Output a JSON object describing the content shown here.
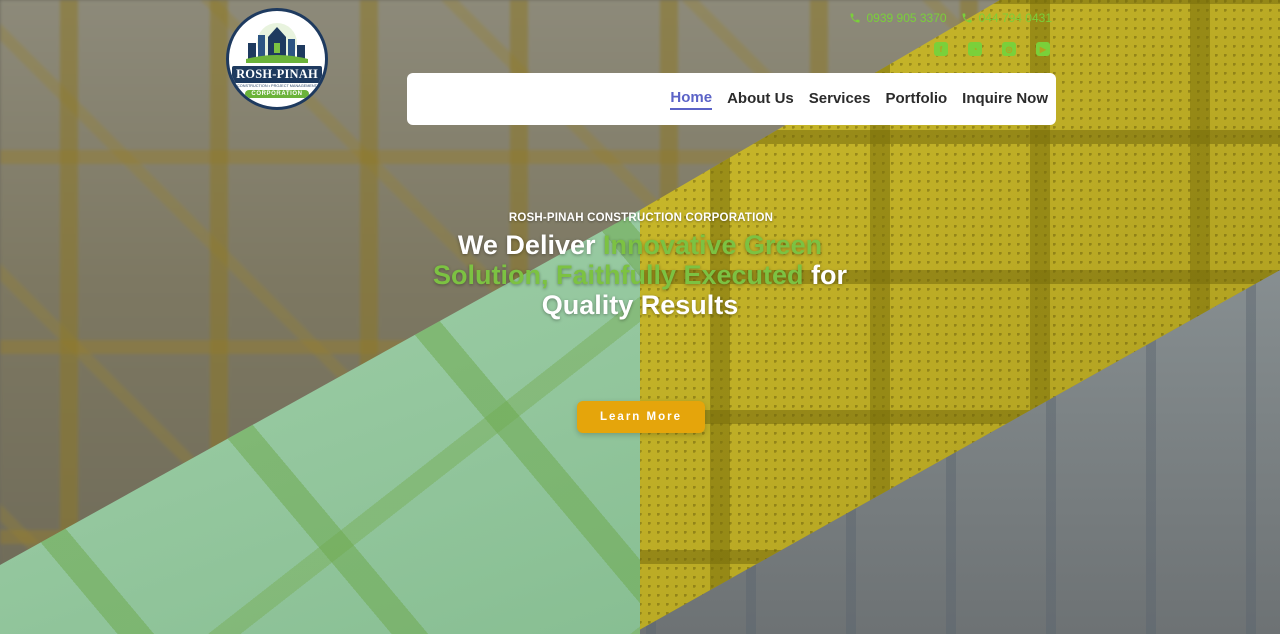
{
  "header": {
    "logo": {
      "name": "ROSH-PINAH",
      "tagline": "CONSTRUCTION • PROJECT MANAGEMENT",
      "corp": "CORPORATION"
    },
    "contacts": [
      {
        "icon": "phone-icon",
        "text": "0939 905 3370"
      },
      {
        "icon": "phone-icon",
        "text": "044 794 0431"
      }
    ],
    "socials": [
      {
        "icon": "facebook-icon"
      },
      {
        "icon": "messenger-icon"
      },
      {
        "icon": "instagram-icon"
      },
      {
        "icon": "youtube-icon"
      }
    ]
  },
  "nav": {
    "items": [
      {
        "label": "Home",
        "active": true
      },
      {
        "label": "About Us"
      },
      {
        "label": "Services"
      },
      {
        "label": "Portfolio"
      },
      {
        "label": "Inquire Now"
      }
    ]
  },
  "hero": {
    "eyebrow": "ROSH-PINAH CONSTRUCTION CORPORATION",
    "headline_part1": "We Deliver ",
    "headline_highlight": "Innovative Green Solution, Faithfully Executed",
    "headline_part2": " for Quality Results",
    "cta_label": "Learn More"
  },
  "colors": {
    "accent_green": "#7cc242",
    "nav_active": "#5b63c7",
    "cta": "#e5a50b",
    "brand_navy": "#1e3a5f"
  }
}
